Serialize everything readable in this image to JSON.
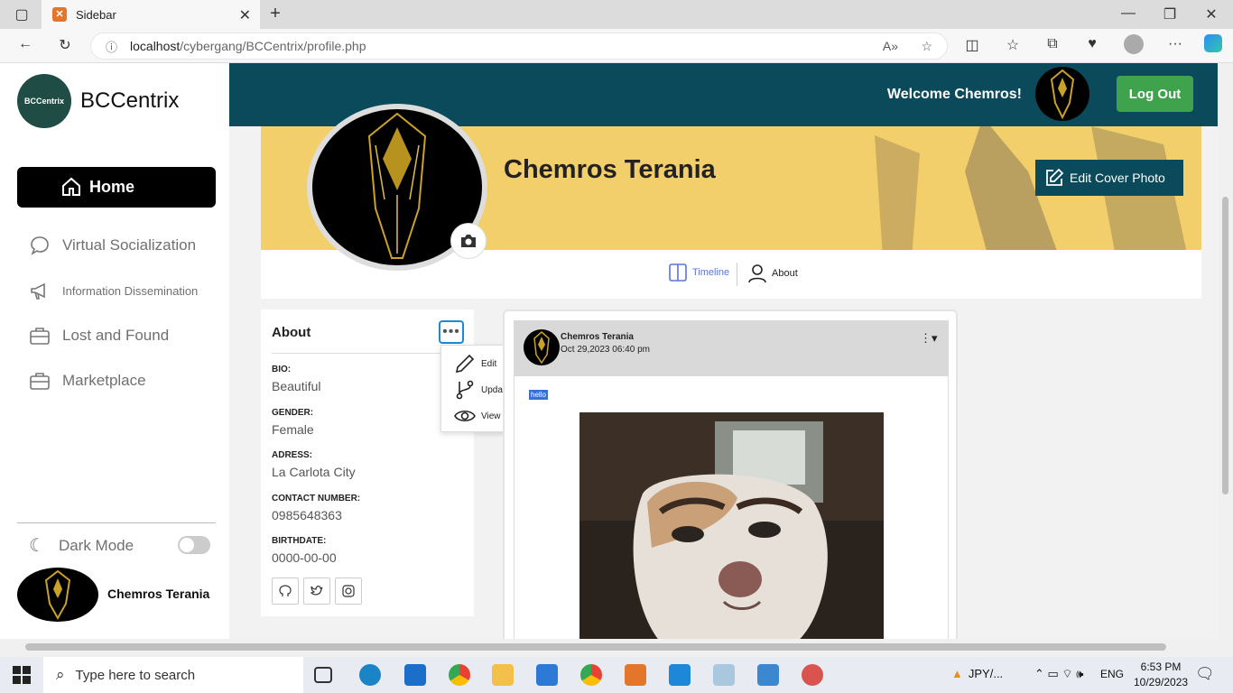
{
  "browser": {
    "tab_title": "Sidebar",
    "url_host": "localhost",
    "url_path": "/cybergang/BCCentrix/profile.php"
  },
  "sidebar": {
    "logo_text": "BCCentrix",
    "brand": "BCCentrix",
    "items": [
      {
        "label": "Home",
        "icon": "home-icon"
      },
      {
        "label": "Virtual Socialization",
        "icon": "chat-icon"
      },
      {
        "label": "Information Dissemination",
        "icon": "megaphone-icon"
      },
      {
        "label": "Lost and Found",
        "icon": "briefcase-icon"
      },
      {
        "label": "Marketplace",
        "icon": "briefcase-icon"
      }
    ],
    "dark_mode_label": "Dark Mode",
    "user_name": "Chemros Terania"
  },
  "topbar": {
    "welcome": "Welcome Chemros!",
    "logout": "Log Out",
    "color": "#0a4a5a"
  },
  "profile": {
    "name": "Chemros Terania",
    "edit_cover": "Edit Cover Photo",
    "tabs": [
      {
        "label": "Timeline",
        "icon": "columns-icon",
        "color": "#5a74d8"
      },
      {
        "label": "About",
        "icon": "user-icon",
        "color": "#222222"
      }
    ]
  },
  "about": {
    "title": "About",
    "fields": [
      {
        "label": "BIO:",
        "value": "Beautiful"
      },
      {
        "label": "GENDER:",
        "value": "Female"
      },
      {
        "label": "ADRESS:",
        "value": "La Carlota City"
      },
      {
        "label": "CONTACT NUMBER:",
        "value": "0985648363"
      },
      {
        "label": "BIRTHDATE:",
        "value": "0000-00-00"
      }
    ],
    "menu": [
      {
        "label": "Edit",
        "icon": "pencil-icon"
      },
      {
        "label": "Update",
        "icon": "branch-icon"
      },
      {
        "label": "View all",
        "icon": "eye-icon"
      }
    ],
    "social": [
      "github-icon",
      "twitter-icon",
      "instagram-icon"
    ]
  },
  "post": {
    "author": "Chemros Terania",
    "date": "Oct 29,2023 06:40 pm",
    "text": "hello"
  },
  "taskbar": {
    "search_placeholder": "Type here to search",
    "currency": "JPY/...",
    "lang": "ENG",
    "time": "6:53 PM",
    "date": "10/29/2023"
  }
}
